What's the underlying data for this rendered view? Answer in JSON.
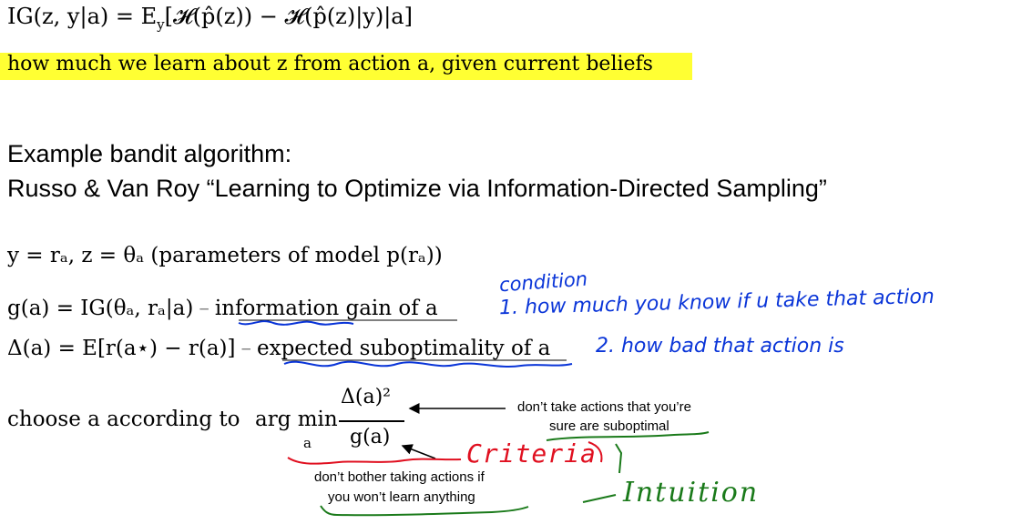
{
  "ig_equation": "IG(z, y|a) = E",
  "ig_equation_sub": "y",
  "ig_equation_rest": "[𝓗(p̂(z)) − 𝓗(p̂(z)|y)|a]",
  "ig_description": "how much we learn about z from action a, given current beliefs",
  "heading_line1": "Example bandit algorithm:",
  "heading_line2": "Russo & Van Roy “Learning to Optimize via Information-Directed Sampling”",
  "definitions": {
    "yz": "y = rₐ, z = θₐ (parameters of model p(rₐ))",
    "g_formula": "g(a) = IG(θₐ, rₐ|a)",
    "g_text": "information gain of a",
    "delta_formula": "Δ(a) = E[r(a⋆) − r(a)]",
    "delta_text": "expected suboptimality of a",
    "dash": "–"
  },
  "choose": {
    "text": "choose a according to",
    "argmin": "arg min",
    "argmin_sub": "a",
    "numerator": "Δ(a)²",
    "denominator": "g(a)"
  },
  "annotations": {
    "suboptimal_line1": "don’t take actions that you’re",
    "suboptimal_line2": "sure are suboptimal",
    "bother_line1": "don’t bother taking actions if",
    "bother_line2": "you won’t learn anything"
  },
  "handwriting": {
    "condition": "condition",
    "line1": "1. how much you know if u take that action",
    "line2": "2. how bad that action is",
    "criteria": "Criteria",
    "intuition": "Intuition"
  },
  "colors": {
    "highlight": "#ffff33",
    "blue_ink": "#0a35d8",
    "red_ink": "#e01020",
    "green_ink": "#1a7a1a"
  }
}
